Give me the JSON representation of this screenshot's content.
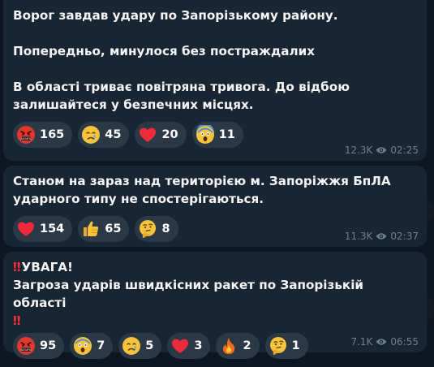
{
  "messages": [
    {
      "alert": "",
      "text": "Ворог завдав удару по Запорізькому району.\n\nПопередньо, минулося без постраждалих\n\nВ області триває повітряна тривога. До відбою залишайтеся у безпечних місцях.",
      "reactions": [
        {
          "icon": "angry-face-icon",
          "count": "165"
        },
        {
          "icon": "crying-face-icon",
          "count": "45"
        },
        {
          "icon": "red-heart-icon",
          "count": "20"
        },
        {
          "icon": "screaming-face-icon",
          "count": "11"
        }
      ],
      "views": "12.3K",
      "time": "02:25"
    },
    {
      "alert": "",
      "text": "Станом на зараз над територією м. Запоріжжя БпЛА ударного типу не спостерігаються.",
      "reactions": [
        {
          "icon": "red-heart-icon",
          "count": "154"
        },
        {
          "icon": "thumbs-up-icon",
          "count": "65"
        },
        {
          "icon": "thinking-face-icon",
          "count": "8"
        }
      ],
      "views": "11.3K",
      "time": "02:37"
    },
    {
      "alert": "‼",
      "text": "УВАГА!\nЗагроза ударів швидкісних ракет по Запорізькій області",
      "alert_end": "‼",
      "reactions": [
        {
          "icon": "angry-face-icon",
          "count": "95"
        },
        {
          "icon": "screaming-face-icon",
          "count": "7"
        },
        {
          "icon": "crying-face-icon",
          "count": "5"
        },
        {
          "icon": "red-heart-icon",
          "count": "3"
        },
        {
          "icon": "fire-icon",
          "count": "2"
        },
        {
          "icon": "thinking-face-icon",
          "count": "1"
        }
      ],
      "views": "7.1K",
      "time": "06:55"
    }
  ]
}
